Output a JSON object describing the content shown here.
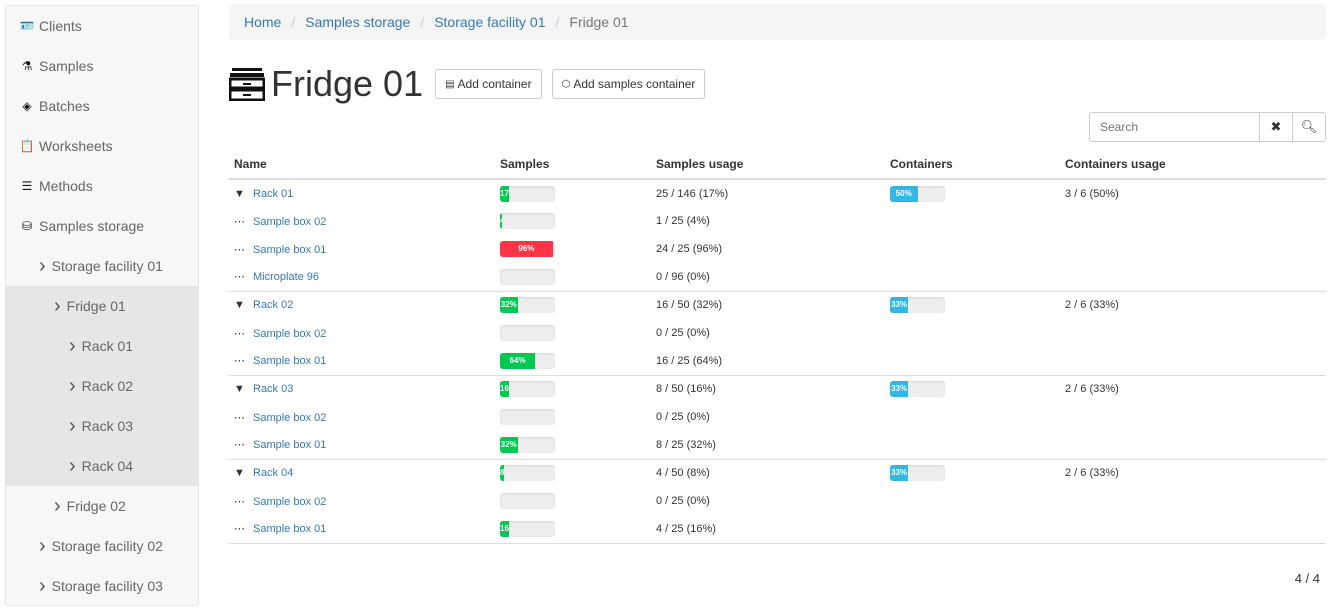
{
  "sidebar": {
    "items": [
      {
        "label": "Clients",
        "icon": "id-card-icon",
        "glyph": "🪪",
        "level": 0
      },
      {
        "label": "Samples",
        "icon": "test-tube-icon",
        "glyph": "⚗",
        "level": 0
      },
      {
        "label": "Batches",
        "icon": "layers-icon",
        "glyph": "◈",
        "level": 0
      },
      {
        "label": "Worksheets",
        "icon": "clipboard-clock-icon",
        "glyph": "📋",
        "level": 0
      },
      {
        "label": "Methods",
        "icon": "list-icon",
        "glyph": "☰",
        "level": 0
      },
      {
        "label": "Samples storage",
        "icon": "database-icon",
        "glyph": "⛁",
        "level": 0
      },
      {
        "label": "Storage facility 01",
        "level": 1
      },
      {
        "label": "Fridge 01",
        "level": 2,
        "active": true
      },
      {
        "label": "Rack 01",
        "level": 3,
        "active": true
      },
      {
        "label": "Rack 02",
        "level": 3,
        "active": true
      },
      {
        "label": "Rack 03",
        "level": 3,
        "active": true
      },
      {
        "label": "Rack 04",
        "level": 3,
        "active": true
      },
      {
        "label": "Fridge 02",
        "level": 2
      },
      {
        "label": "Storage facility 02",
        "level": 1
      },
      {
        "label": "Storage facility 03",
        "level": 1
      }
    ]
  },
  "breadcrumb": [
    "Home",
    "Samples storage",
    "Storage facility 01",
    "Fridge 01"
  ],
  "title": "Fridge 01",
  "buttons": {
    "add_container": "Add container",
    "add_samples_container": "Add samples container"
  },
  "search": {
    "placeholder": "Search",
    "value": ""
  },
  "table": {
    "headers": [
      "Name",
      "Samples",
      "Samples usage",
      "Containers",
      "Containers usage"
    ],
    "rows": [
      {
        "prefix": "▼",
        "name": "Rack 01",
        "samples_pct": 17,
        "samples_usage": "25 / 146 (17%)",
        "containers_pct": 50,
        "containers_usage": "3 / 6 (50%)",
        "first": true
      },
      {
        "prefix": "⋯",
        "name": "Sample box 02",
        "samples_pct": 4,
        "samples_usage": "1 / 25 (4%)"
      },
      {
        "prefix": "⋯",
        "name": "Sample box 01",
        "samples_pct": 96,
        "samples_usage": "24 / 25 (96%)"
      },
      {
        "prefix": "⋯",
        "name": "Microplate 96",
        "samples_pct": 0,
        "samples_usage": "0 / 96 (0%)"
      },
      {
        "prefix": "▼",
        "name": "Rack 02",
        "samples_pct": 32,
        "samples_usage": "16 / 50 (32%)",
        "containers_pct": 33,
        "containers_usage": "2 / 6 (33%)",
        "first": true
      },
      {
        "prefix": "⋯",
        "name": "Sample box 02",
        "samples_pct": 0,
        "samples_usage": "0 / 25 (0%)"
      },
      {
        "prefix": "⋯",
        "name": "Sample box 01",
        "samples_pct": 64,
        "samples_usage": "16 / 25 (64%)"
      },
      {
        "prefix": "▼",
        "name": "Rack 03",
        "samples_pct": 16,
        "samples_usage": "8 / 50 (16%)",
        "containers_pct": 33,
        "containers_usage": "2 / 6 (33%)",
        "first": true
      },
      {
        "prefix": "⋯",
        "name": "Sample box 02",
        "samples_pct": 0,
        "samples_usage": "0 / 25 (0%)"
      },
      {
        "prefix": "⋯",
        "name": "Sample box 01",
        "samples_pct": 32,
        "samples_usage": "8 / 25 (32%)"
      },
      {
        "prefix": "▼",
        "name": "Rack 04",
        "samples_pct": 8,
        "samples_usage": "4 / 50 (8%)",
        "containers_pct": 33,
        "containers_usage": "2 / 6 (33%)",
        "first": true
      },
      {
        "prefix": "⋯",
        "name": "Sample box 02",
        "samples_pct": 0,
        "samples_usage": "0 / 25 (0%)"
      },
      {
        "prefix": "⋯",
        "name": "Sample box 01",
        "samples_pct": 16,
        "samples_usage": "4 / 25 (16%)"
      }
    ]
  },
  "colors": {
    "ok": "#00c851",
    "danger": "#ff3547",
    "info": "#33b5e5"
  },
  "pager": "4 / 4"
}
